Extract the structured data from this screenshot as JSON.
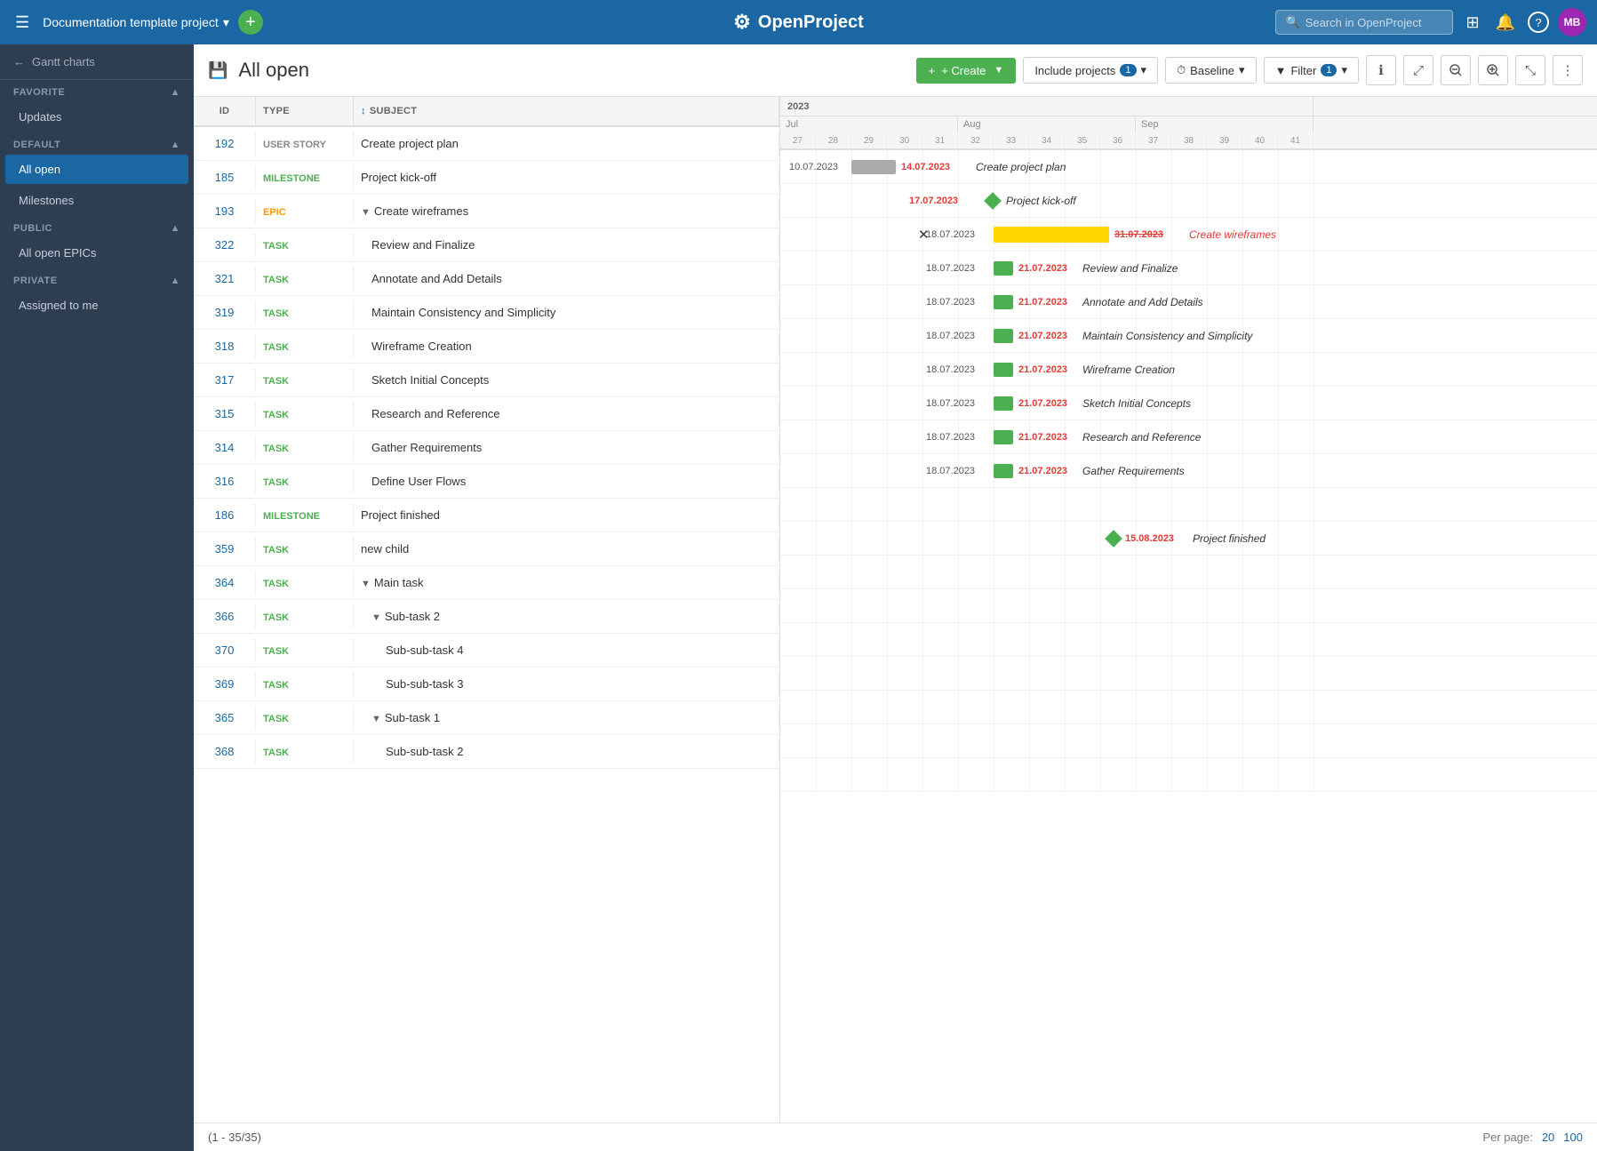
{
  "topbar": {
    "menu_icon": "☰",
    "project_name": "Documentation template project",
    "project_dropdown": "▾",
    "plus_btn": "+",
    "logo_text": "OpenProject",
    "search_placeholder": "Search in OpenProject",
    "search_icon": "🔍",
    "grid_icon": "⊞",
    "bell_icon": "🔔",
    "help_icon": "?",
    "avatar_text": "MB"
  },
  "sidebar": {
    "back_label": "← Back",
    "title": "Gantt charts",
    "sections": [
      {
        "id": "favorite",
        "label": "FAVORITE",
        "collapsed": false,
        "items": [
          {
            "id": "updates",
            "label": "Updates",
            "active": false
          }
        ]
      },
      {
        "id": "default",
        "label": "DEFAULT",
        "collapsed": false,
        "items": [
          {
            "id": "all-open",
            "label": "All open",
            "active": true
          },
          {
            "id": "milestones",
            "label": "Milestones",
            "active": false
          }
        ]
      },
      {
        "id": "public",
        "label": "PUBLIC",
        "collapsed": false,
        "items": [
          {
            "id": "all-open-epics",
            "label": "All open EPICs",
            "active": false
          }
        ]
      },
      {
        "id": "private",
        "label": "PRIVATE",
        "collapsed": false,
        "items": [
          {
            "id": "assigned-to-me",
            "label": "Assigned to me",
            "active": false
          }
        ]
      }
    ]
  },
  "header": {
    "save_icon": "💾",
    "title": "All open",
    "create_label": "+ Create",
    "include_projects_label": "Include projects",
    "include_projects_count": "1",
    "baseline_label": "Baseline",
    "filter_label": "Filter",
    "filter_count": "1",
    "info_icon": "ℹ",
    "fullscreen_icon": "⤢",
    "zoom_out_icon": "🔍",
    "zoom_in_icon": "🔍",
    "fit_icon": "⤡",
    "more_icon": "⋮"
  },
  "table": {
    "columns": [
      "ID",
      "TYPE",
      "SUBJECT"
    ],
    "rows": [
      {
        "id": "192",
        "type": "USER STORY",
        "type_class": "user-story",
        "subject": "Create project plan",
        "indent": 0,
        "collapse": false
      },
      {
        "id": "185",
        "type": "MILESTONE",
        "type_class": "milestone",
        "subject": "Project kick-off",
        "indent": 0,
        "collapse": false
      },
      {
        "id": "193",
        "type": "EPIC",
        "type_class": "epic",
        "subject": "Create wireframes",
        "indent": 0,
        "collapse": true
      },
      {
        "id": "322",
        "type": "TASK",
        "type_class": "task",
        "subject": "Review and Finalize",
        "indent": 1,
        "collapse": false
      },
      {
        "id": "321",
        "type": "TASK",
        "type_class": "task",
        "subject": "Annotate and Add Details",
        "indent": 1,
        "collapse": false
      },
      {
        "id": "319",
        "type": "TASK",
        "type_class": "task",
        "subject": "Maintain Consistency and Simplicity",
        "indent": 1,
        "collapse": false
      },
      {
        "id": "318",
        "type": "TASK",
        "type_class": "task",
        "subject": "Wireframe Creation",
        "indent": 1,
        "collapse": false
      },
      {
        "id": "317",
        "type": "TASK",
        "type_class": "task",
        "subject": "Sketch Initial Concepts",
        "indent": 1,
        "collapse": false
      },
      {
        "id": "315",
        "type": "TASK",
        "type_class": "task",
        "subject": "Research and Reference",
        "indent": 1,
        "collapse": false
      },
      {
        "id": "314",
        "type": "TASK",
        "type_class": "task",
        "subject": "Gather Requirements",
        "indent": 1,
        "collapse": false
      },
      {
        "id": "316",
        "type": "TASK",
        "type_class": "task",
        "subject": "Define User Flows",
        "indent": 1,
        "collapse": false
      },
      {
        "id": "186",
        "type": "MILESTONE",
        "type_class": "milestone",
        "subject": "Project finished",
        "indent": 0,
        "collapse": false
      },
      {
        "id": "359",
        "type": "TASK",
        "type_class": "task",
        "subject": "new child",
        "indent": 0,
        "collapse": false
      },
      {
        "id": "364",
        "type": "TASK",
        "type_class": "task",
        "subject": "Main task",
        "indent": 0,
        "collapse": true
      },
      {
        "id": "366",
        "type": "TASK",
        "type_class": "task",
        "subject": "Sub-task 2",
        "indent": 1,
        "collapse": true
      },
      {
        "id": "370",
        "type": "TASK",
        "type_class": "task",
        "subject": "Sub-sub-task 4",
        "indent": 2,
        "collapse": false
      },
      {
        "id": "369",
        "type": "TASK",
        "type_class": "task",
        "subject": "Sub-sub-task 3",
        "indent": 2,
        "collapse": false
      },
      {
        "id": "365",
        "type": "TASK",
        "type_class": "task",
        "subject": "Sub-task 1",
        "indent": 1,
        "collapse": true
      },
      {
        "id": "368",
        "type": "TASK",
        "type_class": "task",
        "subject": "Sub-sub-task 2",
        "indent": 2,
        "collapse": false
      }
    ]
  },
  "gantt": {
    "year": "2023",
    "months": [
      "Jul",
      "Aug",
      "Sep"
    ],
    "weeks": [
      "27",
      "28",
      "29",
      "30",
      "31",
      "32",
      "33",
      "34",
      "35",
      "36",
      "37",
      "38",
      "39",
      "40",
      "41"
    ],
    "rows": [
      {
        "type": "bar",
        "start_pct": 0,
        "width_pct": 8,
        "bar_class": "gray",
        "date_label": "10.07.2023",
        "end_date": "14.07.2023",
        "end_date_class": "overdue",
        "label_text": "Create project plan",
        "label_class": "normal"
      },
      {
        "type": "milestone",
        "pos_pct": 16,
        "date_label": "17.07.2023",
        "date_class": "overdue",
        "label_text": "Project kick-off",
        "label_class": "normal"
      },
      {
        "type": "pin-bar",
        "pin_pct": 22,
        "bar_start_pct": 22,
        "bar_width_pct": 22,
        "bar_class": "yellow",
        "date_label": "18.07.2023",
        "end_date": "31.07.2023",
        "end_date_class": "overdue",
        "label_text": "Create wireframes",
        "label_class": "overdue-line"
      },
      {
        "type": "bar",
        "start_pct": 22,
        "width_pct": 3,
        "bar_class": "green",
        "date_label": "18.07.2023",
        "end_date": "21.07.2023",
        "end_date_class": "overdue",
        "label_text": "Review and Finalize",
        "label_class": "italic"
      },
      {
        "type": "bar",
        "start_pct": 22,
        "width_pct": 3,
        "bar_class": "green",
        "date_label": "18.07.2023",
        "end_date": "21.07.2023",
        "end_date_class": "overdue",
        "label_text": "Annotate and Add Details",
        "label_class": "italic"
      },
      {
        "type": "bar",
        "start_pct": 22,
        "width_pct": 3,
        "bar_class": "green",
        "date_label": "18.07.2023",
        "end_date": "21.07.2023",
        "end_date_class": "overdue",
        "label_text": "Maintain Consistency and Simplicity",
        "label_class": "italic"
      },
      {
        "type": "bar",
        "start_pct": 22,
        "width_pct": 3,
        "bar_class": "green",
        "date_label": "18.07.2023",
        "end_date": "21.07.2023",
        "end_date_class": "overdue",
        "label_text": "Wireframe Creation",
        "label_class": "italic"
      },
      {
        "type": "bar",
        "start_pct": 22,
        "width_pct": 3,
        "bar_class": "green",
        "date_label": "18.07.2023",
        "end_date": "21.07.2023",
        "end_date_class": "overdue",
        "label_text": "Sketch Initial Concepts",
        "label_class": "italic"
      },
      {
        "type": "bar",
        "start_pct": 22,
        "width_pct": 3,
        "bar_class": "green",
        "date_label": "18.07.2023",
        "end_date": "21.07.2023",
        "end_date_class": "overdue",
        "label_text": "Research and Reference",
        "label_class": "italic"
      },
      {
        "type": "bar",
        "start_pct": 22,
        "width_pct": 3,
        "bar_class": "green",
        "date_label": "18.07.2023",
        "end_date": "21.07.2023",
        "end_date_class": "overdue",
        "label_text": "Gather Requirements",
        "label_class": "italic"
      },
      {
        "type": "empty",
        "date_label": "",
        "end_date": "",
        "label_text": ""
      },
      {
        "type": "milestone",
        "pos_pct": 52,
        "date_label": "15.08.2023",
        "date_class": "overdue",
        "label_text": "Project finished",
        "label_class": "italic"
      },
      {
        "type": "empty"
      },
      {
        "type": "empty"
      },
      {
        "type": "empty"
      },
      {
        "type": "empty"
      },
      {
        "type": "empty"
      },
      {
        "type": "empty"
      },
      {
        "type": "empty"
      }
    ]
  },
  "footer": {
    "pagination": "(1 - 35/35)",
    "per_page_label": "Per page:",
    "per_page_options": [
      "20",
      "100"
    ],
    "per_page_current": "20",
    "per_page_other": "100"
  }
}
